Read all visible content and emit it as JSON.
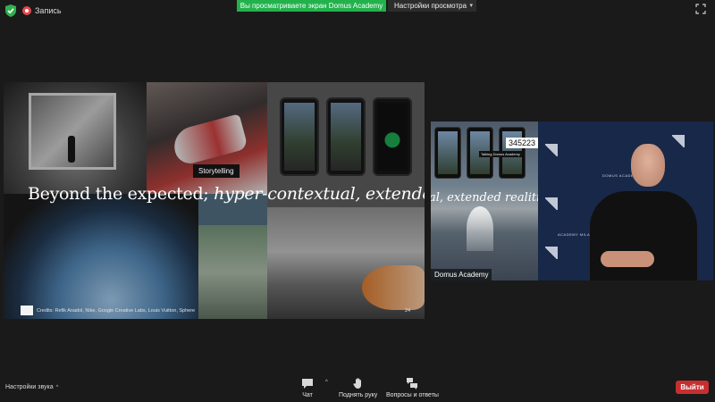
{
  "topbar": {
    "security_icon": "shield-check-icon",
    "recording_label": "Запись",
    "share_banner": "Вы просматриваете экран Domus Academy",
    "view_settings_label": "Настройки просмотра",
    "accent_green": "#22b24c"
  },
  "slide": {
    "tag": "Storytelling",
    "headline_regular": "Beyond the expected; ",
    "headline_italic": "hyper-contextual, extended realities",
    "credits": "Credits: Refik Anadol, Nike, Google Creative Labs, Louis Vuitton, Sphere",
    "page_number": "24"
  },
  "video": {
    "participant_name": "Domus Academy",
    "slide_echo_text": "al, extended realities",
    "slide_echo_number": "345223",
    "slide_echo_tag": "Talking Domus Academy",
    "brand_text_1": "DOMUS ACADEMY",
    "brand_text_2": "ACADEMY MILANO"
  },
  "bottombar": {
    "audio_settings_label": "Настройки звука",
    "chat_label": "Чат",
    "raise_hand_label": "Поднять руку",
    "qa_label": "Вопросы и ответы",
    "leave_label": "Выйти",
    "leave_color": "#c72f2f"
  }
}
